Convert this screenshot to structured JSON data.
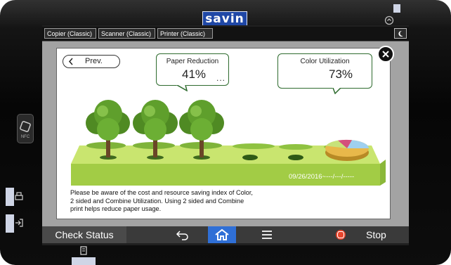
{
  "brand": {
    "logo_text": "savin",
    "logo_color": "#1f47a6"
  },
  "tabs": [
    {
      "label": "Copier (Classic)"
    },
    {
      "label": "Scanner (Classic)"
    },
    {
      "label": "Printer (Classic)"
    }
  ],
  "panel": {
    "prev_label": "Prev.",
    "paper_reduction": {
      "title": "Paper Reduction",
      "value": "41%",
      "more": "..."
    },
    "color_utilization": {
      "title": "Color Utilization",
      "value": "73%"
    },
    "date_text": "09/26/2016~---/---/-----",
    "description": "Please be aware of the cost and resource saving index of Color, 2 sided and Combine Utilization. Using 2 sided and Combine print helps reduce paper usage.",
    "trees_shown": 3,
    "tree_holes": 2,
    "pie_slices": [
      {
        "color": "#e8b84a",
        "share": 0.62
      },
      {
        "color": "#9fd0ef",
        "share": 0.18
      },
      {
        "color": "#d44f7c",
        "share": 0.08
      },
      {
        "color": "#c7e27a",
        "share": 0.12
      }
    ]
  },
  "bottom_bar": {
    "check_status_label": "Check Status",
    "stop_label": "Stop",
    "home_color": "#2f6fd6",
    "icons": [
      "back-arrow-icon",
      "home-icon",
      "menu-icon",
      "stop-icon"
    ]
  },
  "side": {
    "nfc_label": "NFC"
  }
}
